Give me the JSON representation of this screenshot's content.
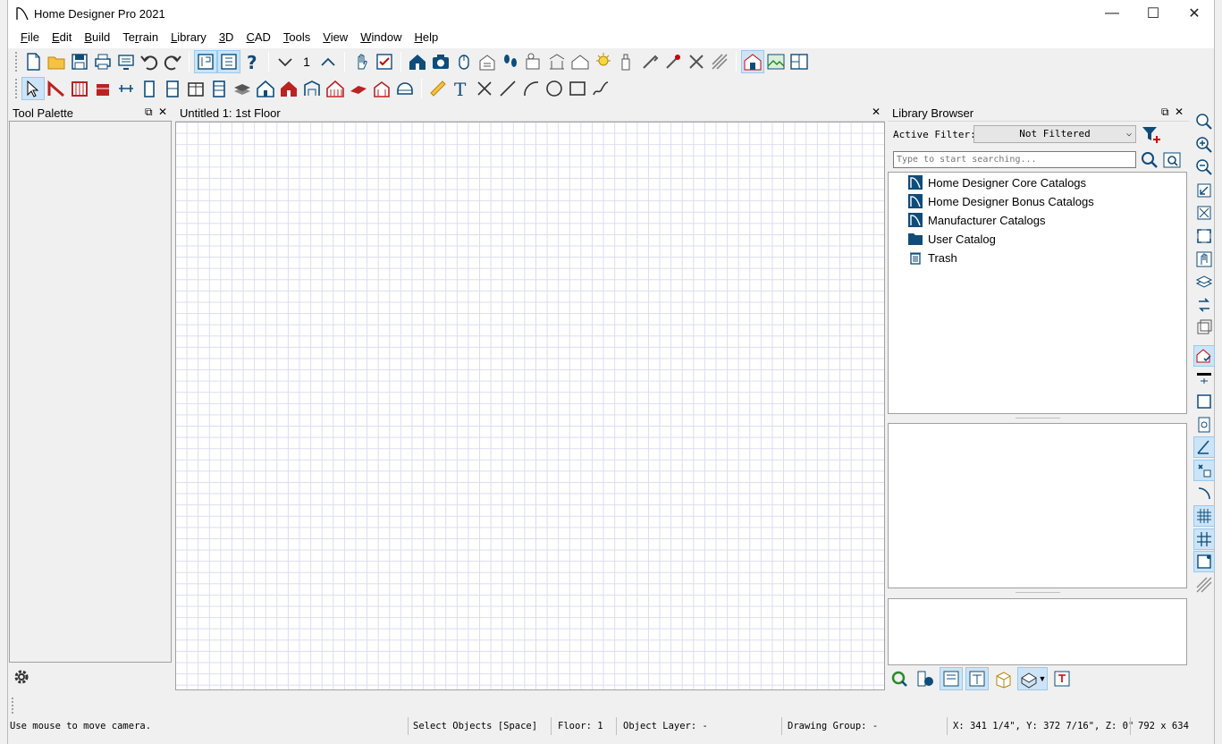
{
  "window": {
    "title": "Home Designer Pro 2021"
  },
  "window_controls": {
    "minimize": "—",
    "maximize": "☐",
    "close": "✕"
  },
  "menu": [
    {
      "label": "File",
      "mnemonic": "F",
      "rest": "ile"
    },
    {
      "label": "Edit",
      "mnemonic": "E",
      "rest": "dit"
    },
    {
      "label": "Build",
      "mnemonic": "B",
      "rest": "uild"
    },
    {
      "label": "Terrain",
      "pre": "Te",
      "mnemonic": "r",
      "rest": "rain"
    },
    {
      "label": "Library",
      "mnemonic": "L",
      "rest": "ibrary"
    },
    {
      "label": "3D",
      "mnemonic": "3",
      "rest": "D"
    },
    {
      "label": "CAD",
      "mnemonic": "C",
      "rest": "AD"
    },
    {
      "label": "Tools",
      "mnemonic": "T",
      "rest": "ools"
    },
    {
      "label": "View",
      "mnemonic": "V",
      "rest": "iew"
    },
    {
      "label": "Window",
      "mnemonic": "W",
      "rest": "indow"
    },
    {
      "label": "Help",
      "mnemonic": "H",
      "rest": "elp"
    }
  ],
  "toolbar1": {
    "floor_number": "1"
  },
  "tool_palette": {
    "title": "Tool Palette"
  },
  "drawing": {
    "tab_title": "Untitled 1: 1st Floor"
  },
  "library": {
    "title": "Library Browser",
    "active_filter_label": "Active Filter:",
    "filter_value": "Not Filtered",
    "search_placeholder": "Type to start searching...",
    "catalogs": [
      {
        "label": "Home Designer Core Catalogs",
        "icon": "catalog-icon"
      },
      {
        "label": "Home Designer Bonus Catalogs",
        "icon": "catalog-icon"
      },
      {
        "label": "Manufacturer Catalogs",
        "icon": "catalog-icon"
      },
      {
        "label": "User Catalog",
        "icon": "folder-icon"
      },
      {
        "label": "Trash",
        "icon": "trash-icon"
      }
    ]
  },
  "status": {
    "hint": "Use mouse to move camera.",
    "mode": "Select Objects [Space]",
    "floor": "Floor: 1",
    "object_layer": "Object Layer: -",
    "drawing_group": "Drawing Group: -",
    "coordinates": "X: 341 1/4\", Y: 372 7/16\", Z: 0\"",
    "view_size": "792 x 634"
  },
  "colors": {
    "accent": "#0f4c7a",
    "highlight": "#cce4f7",
    "grid": "#dcdcf0"
  }
}
